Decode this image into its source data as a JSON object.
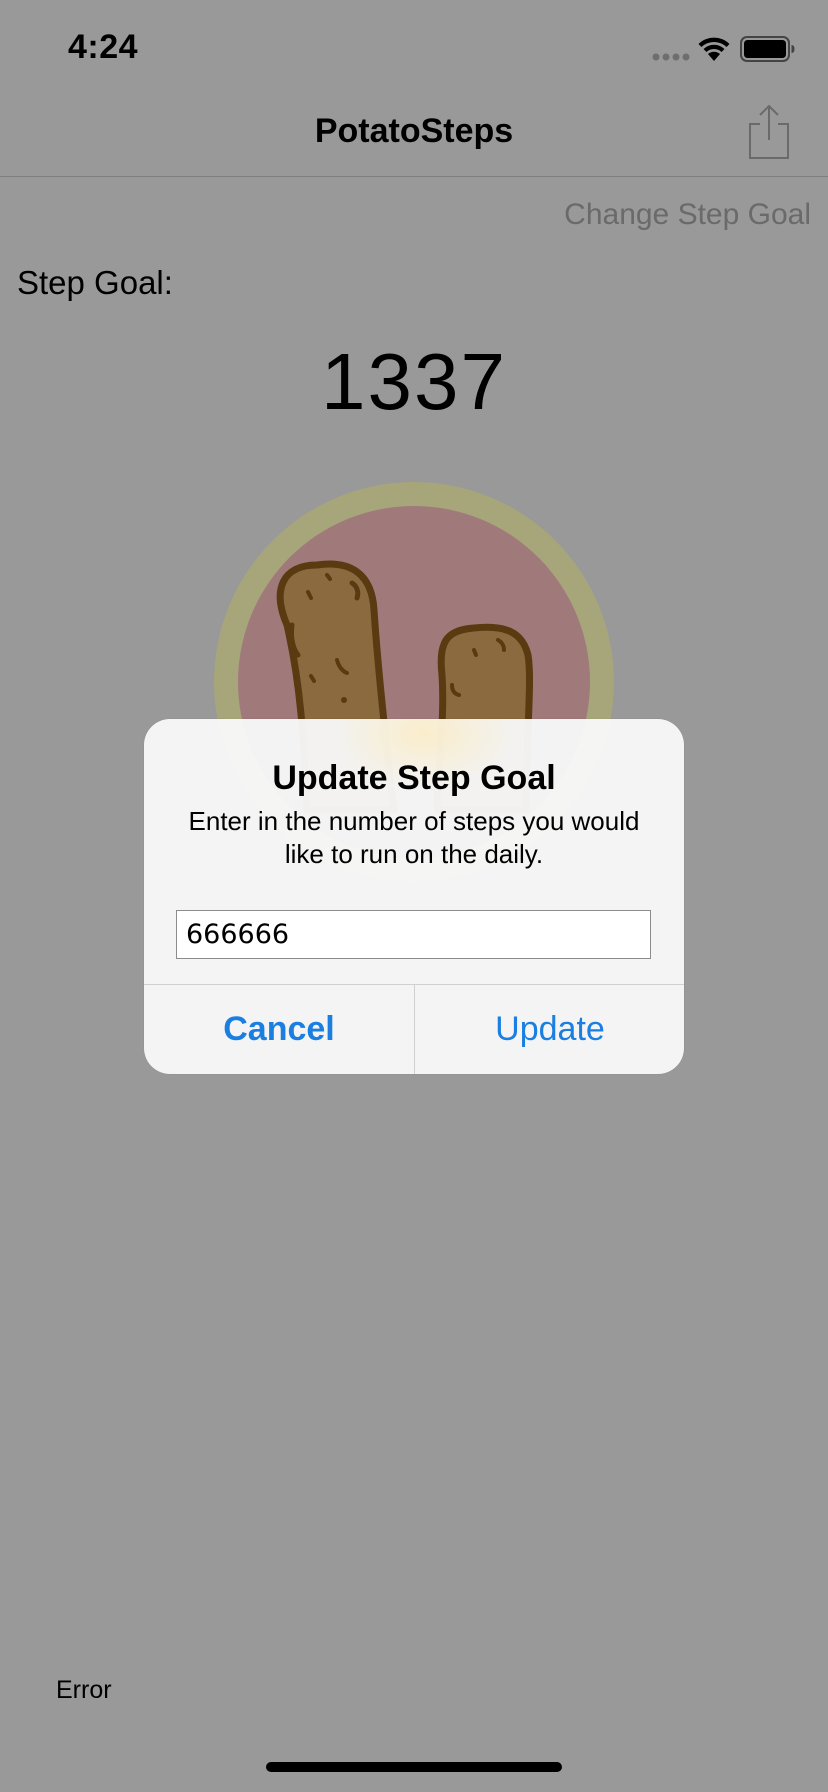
{
  "status_bar": {
    "time": "4:24",
    "icons": [
      "signal-icon",
      "wifi-icon",
      "battery-icon"
    ]
  },
  "nav": {
    "title": "PotatoSteps",
    "share_icon": "share-icon"
  },
  "main": {
    "change_goal_label": "Change Step Goal",
    "step_goal_label": "Step Goal:",
    "step_goal_value": "1337",
    "error_label": "Error"
  },
  "alert": {
    "title": "Update Step Goal",
    "message": "Enter in the number of steps you would like to run on the daily.",
    "input_value": "666666",
    "cancel_label": "Cancel",
    "update_label": "Update"
  },
  "colors": {
    "background_dimmed": "#999999",
    "alert_button": "#1a7fe0",
    "ring": "#a7a57a",
    "circle_fill": "#a07a7a",
    "potato": "#8a6a3e"
  }
}
